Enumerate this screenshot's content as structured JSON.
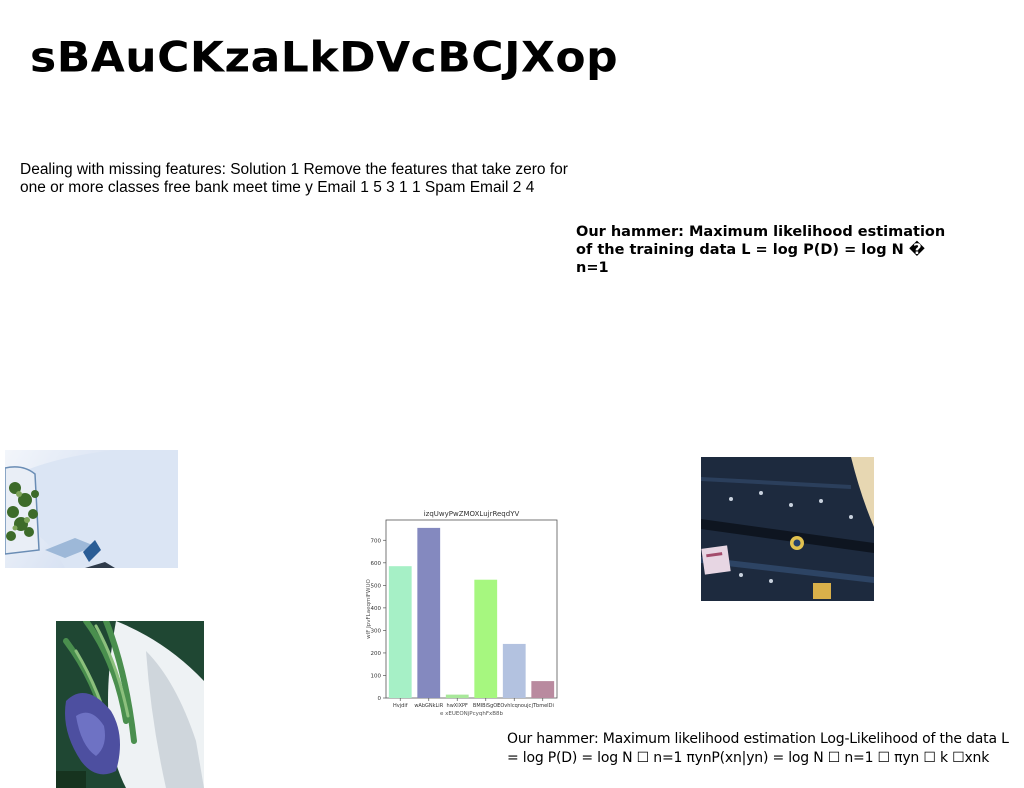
{
  "page": {
    "title": "sBAuCKzaLkDVcBCJXop",
    "text1": "Dealing with missing features: Solution 1 Remove the features that take zero for one or more classes free bank meet time y Email 1 5 3 1 1 Spam Email 2 4",
    "text2": "Our hammer: Maximum likelihood estimation of the training data L = log P(D) = log N � n=1",
    "text3": "Our hammer: Maximum likelihood estimation Log-Likelihood of the data L = log P(D) = log N ☐ n=1 πynP(xn|yn) = log N ☐ n=1 ☐ πyn ☐ k ☐xnk"
  },
  "chart_data": {
    "type": "bar",
    "title": "izqUwyPwZMOXLujrReqdYV",
    "xlabel": "e xEUEONjPcyqhFxB8b",
    "ylabel": "wlF JpvFLaeqmlFWUO",
    "categories": [
      "Hvjdif",
      "wAbGNkLiR",
      "hwXlXPF",
      "BMIBiSgOl",
      "EOvhlcqnoujc",
      "jTbmeIDi"
    ],
    "values": [
      585,
      755,
      15,
      525,
      240,
      75
    ],
    "colors": [
      "#a6f0c6",
      "#8489bf",
      "#a8e89a",
      "#a6f77f",
      "#b3c2e0",
      "#b98a9f"
    ],
    "ylim": [
      0,
      790
    ],
    "yticks": [
      0,
      100,
      200,
      300,
      400,
      500,
      600,
      700
    ],
    "grid": false,
    "legend": "none"
  }
}
